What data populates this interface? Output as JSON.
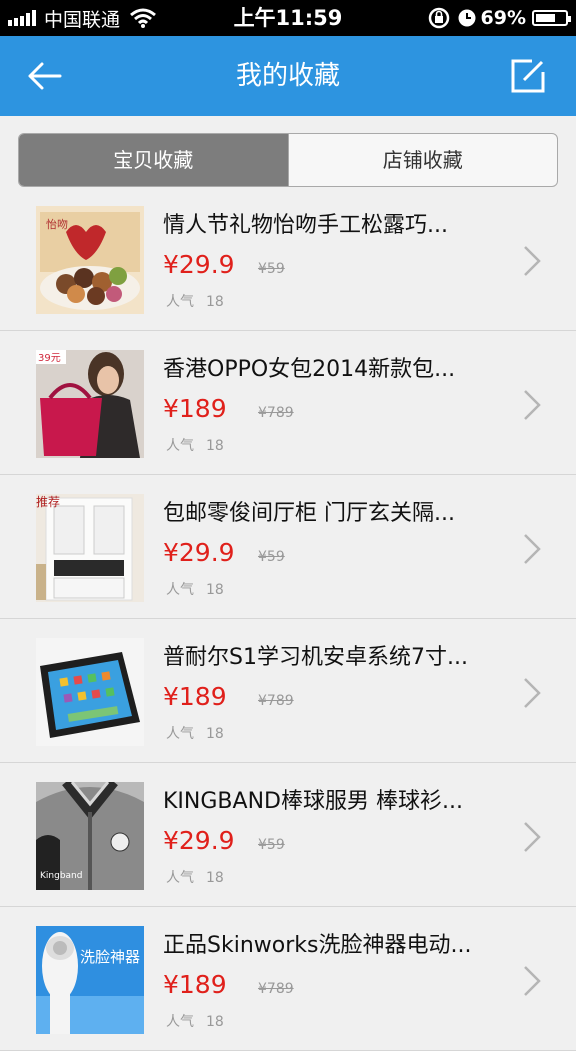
{
  "status_bar": {
    "carrier": "中国联通",
    "time": "上午11:59",
    "battery": "69%",
    "battery_level": 0.69
  },
  "nav": {
    "title": "我的收藏",
    "back_icon": "back-arrow-icon",
    "edit_icon": "edit-icon"
  },
  "tabs": [
    {
      "label": "宝贝收藏",
      "active": true
    },
    {
      "label": "店铺收藏",
      "active": false
    }
  ],
  "colors": {
    "nav": "#2d94e0",
    "price": "#e0201b",
    "active_tab": "#7d7d7d"
  },
  "items": [
    {
      "title": "情人节礼物怡吻手工松露巧...",
      "price": "¥29.9",
      "original": "¥59",
      "popularity_label": "人气",
      "popularity": "18"
    },
    {
      "title": "香港OPPO女包2014新款包...",
      "price": "¥189",
      "original": "¥789",
      "popularity_label": "人气",
      "popularity": "18"
    },
    {
      "title": "包邮零俊间厅柜  门厅玄关隔...",
      "price": "¥29.9",
      "original": "¥59",
      "popularity_label": "人气",
      "popularity": "18"
    },
    {
      "title": "普耐尔S1学习机安卓系统7寸...",
      "price": "¥189",
      "original": "¥789",
      "popularity_label": "人气",
      "popularity": "18"
    },
    {
      "title": "KINGBAND棒球服男 棒球衫...",
      "price": "¥29.9",
      "original": "¥59",
      "popularity_label": "人气",
      "popularity": "18"
    },
    {
      "title": "正品Skinworks洗脸神器电动...",
      "price": "¥189",
      "original": "¥789",
      "popularity_label": "人气",
      "popularity": "18"
    }
  ]
}
